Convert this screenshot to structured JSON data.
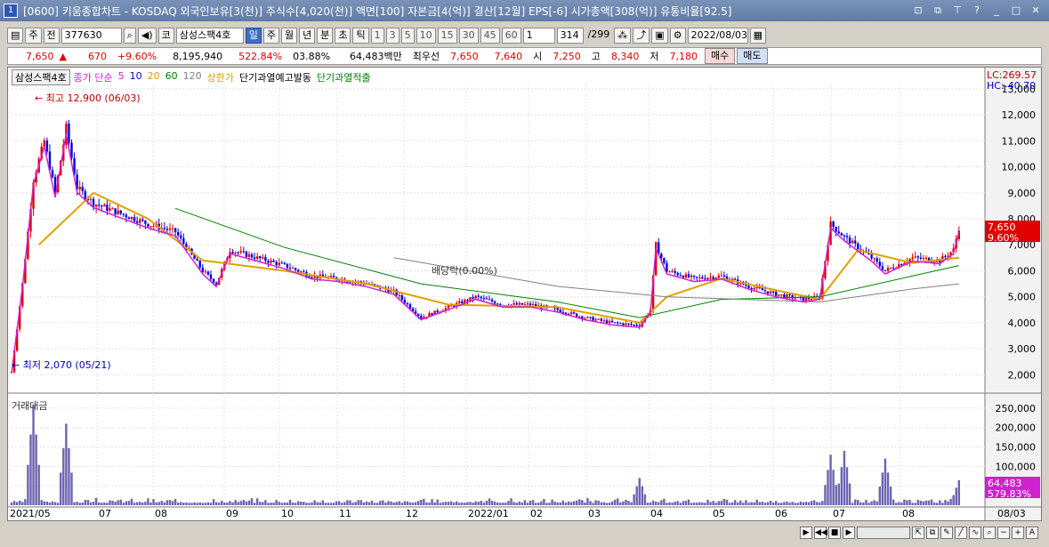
{
  "window": {
    "title": "[0600] 키움종합차트 - KOSDAQ 외국인보유[3(천)] 주식수[4,020(천)] 액면[100] 자본금[4(억)] 결산[12월] EPS[-6] 시가총액[308(억)] 유통비율[92.5]",
    "win_icon": "1"
  },
  "toolbar": {
    "type1": "주",
    "type2": "전",
    "code": "377630",
    "name_prefix": "코",
    "name": "삼성스팩4호",
    "periods": [
      "일",
      "주",
      "월",
      "년",
      "분",
      "초",
      "틱"
    ],
    "active_period": "일",
    "intervals": [
      "1",
      "3",
      "5",
      "10",
      "15",
      "30",
      "45",
      "60"
    ],
    "count_sel": "1",
    "count": "314",
    "count_total": "/299",
    "date": "2022/08/03"
  },
  "quote": {
    "price": "7,650",
    "arrow": "▲",
    "change": "670",
    "change_pct": "+9.60%",
    "volume": "8,195,940",
    "vol_ratio": "522.84%",
    "turnover": "03.88%",
    "amount": "64,483백만",
    "best_label": "최우선",
    "ask": "7,650",
    "bid": "7,640",
    "open_label": "시",
    "open": "7,250",
    "high_label": "고",
    "high": "8,340",
    "low_label": "저",
    "low": "7,180",
    "buy_btn": "매수",
    "sell_btn": "매도"
  },
  "legend": {
    "name": "삼성스팩4호",
    "items": [
      {
        "t": "종가 단순",
        "c": "#d020d0"
      },
      {
        "t": "5",
        "c": "#d020d0"
      },
      {
        "t": "10",
        "c": "#0000d0"
      },
      {
        "t": "20",
        "c": "#e0a000"
      },
      {
        "t": "60",
        "c": "#008000"
      },
      {
        "t": "120",
        "c": "#808080"
      },
      {
        "t": "상한가",
        "c": "#e0a000"
      },
      {
        "t": "단기과열예고발동",
        "c": "#000000"
      },
      {
        "t": "단기과열적출",
        "c": "#008000"
      }
    ]
  },
  "annotations": {
    "high": "최고 12,900 (06/03)",
    "low": "최저 2,070 (05/21)",
    "dividend": "배당락(0.00%)",
    "lc": "LC:269.57",
    "hc": "HC:-40.70",
    "price_tag": "7,650",
    "pct_tag": "9.60%",
    "vol_tag": "64,483",
    "vol_pct_tag": "579.83%"
  },
  "volume_label": "거래대금",
  "icons": {
    "grid": "grid-icon",
    "search": "search-icon",
    "speaker": "speaker-icon",
    "settings": "gear-icon",
    "save": "save-icon",
    "calendar": "calendar-icon"
  },
  "colors": {
    "up": "#e00000",
    "down": "#0000e0",
    "ma5": "#d020d0",
    "ma20": "#e0a000",
    "ma60": "#008000",
    "ma120": "#808080",
    "volume": "#6b64b0"
  },
  "chart_data": {
    "type": "candlestick",
    "title": "",
    "y_axis": {
      "ticks": [
        2000,
        3000,
        4000,
        5000,
        6000,
        7000,
        8000,
        9000,
        10000,
        11000,
        12000,
        13000
      ],
      "range": [
        1500,
        13200
      ]
    },
    "x_axis": {
      "ticks": [
        "2021/05",
        "07",
        "08",
        "09",
        "10",
        "11",
        "12",
        "2022/01",
        "02",
        "03",
        "04",
        "05",
        "06",
        "07",
        "08",
        "08/03"
      ]
    },
    "close_series": [
      [
        0,
        2100
      ],
      [
        4,
        5500
      ],
      [
        8,
        9500
      ],
      [
        12,
        11000
      ],
      [
        16,
        9000
      ],
      [
        20,
        11500
      ],
      [
        24,
        9200
      ],
      [
        30,
        8600
      ],
      [
        40,
        8200
      ],
      [
        50,
        7800
      ],
      [
        60,
        7500
      ],
      [
        70,
        6000
      ],
      [
        75,
        5500
      ],
      [
        80,
        6800
      ],
      [
        90,
        6500
      ],
      [
        100,
        6200
      ],
      [
        110,
        5800
      ],
      [
        120,
        5700
      ],
      [
        130,
        5500
      ],
      [
        140,
        5200
      ],
      [
        150,
        4200
      ],
      [
        160,
        4600
      ],
      [
        170,
        5000
      ],
      [
        180,
        4700
      ],
      [
        190,
        4700
      ],
      [
        200,
        4500
      ],
      [
        210,
        4200
      ],
      [
        220,
        4000
      ],
      [
        230,
        3900
      ],
      [
        234,
        4500
      ],
      [
        236,
        7000
      ],
      [
        240,
        6000
      ],
      [
        250,
        5700
      ],
      [
        260,
        5800
      ],
      [
        270,
        5400
      ],
      [
        280,
        5100
      ],
      [
        290,
        4900
      ],
      [
        296,
        5000
      ],
      [
        300,
        7800
      ],
      [
        305,
        7300
      ],
      [
        315,
        6500
      ],
      [
        320,
        6000
      ],
      [
        330,
        6500
      ],
      [
        340,
        6400
      ],
      [
        345,
        6800
      ],
      [
        347,
        7650
      ]
    ],
    "ma_series": [
      {
        "name": "20",
        "values": [
          [
            10,
            7000
          ],
          [
            30,
            9000
          ],
          [
            50,
            8000
          ],
          [
            70,
            6400
          ],
          [
            100,
            6000
          ],
          [
            130,
            5500
          ],
          [
            160,
            4700
          ],
          [
            200,
            4600
          ],
          [
            230,
            4000
          ],
          [
            240,
            5000
          ],
          [
            260,
            5700
          ],
          [
            296,
            4900
          ],
          [
            310,
            6800
          ],
          [
            330,
            6300
          ],
          [
            347,
            6500
          ]
        ]
      },
      {
        "name": "60",
        "values": [
          [
            60,
            8400
          ],
          [
            100,
            6900
          ],
          [
            150,
            5500
          ],
          [
            200,
            4800
          ],
          [
            230,
            4200
          ],
          [
            260,
            4900
          ],
          [
            296,
            5000
          ],
          [
            330,
            5800
          ],
          [
            347,
            6200
          ]
        ]
      },
      {
        "name": "120",
        "values": [
          [
            140,
            6500
          ],
          [
            200,
            5400
          ],
          [
            240,
            5000
          ],
          [
            296,
            4800
          ],
          [
            330,
            5300
          ],
          [
            347,
            5500
          ]
        ]
      }
    ],
    "volume": {
      "name": "거래대금",
      "y_ticks": [
        50000,
        100000,
        150000,
        200000,
        250000
      ],
      "highs": [
        [
          8,
          260000
        ],
        [
          20,
          210000
        ],
        [
          230,
          70000
        ],
        [
          300,
          130000
        ],
        [
          305,
          140000
        ],
        [
          320,
          120000
        ],
        [
          347,
          64483
        ]
      ]
    }
  }
}
